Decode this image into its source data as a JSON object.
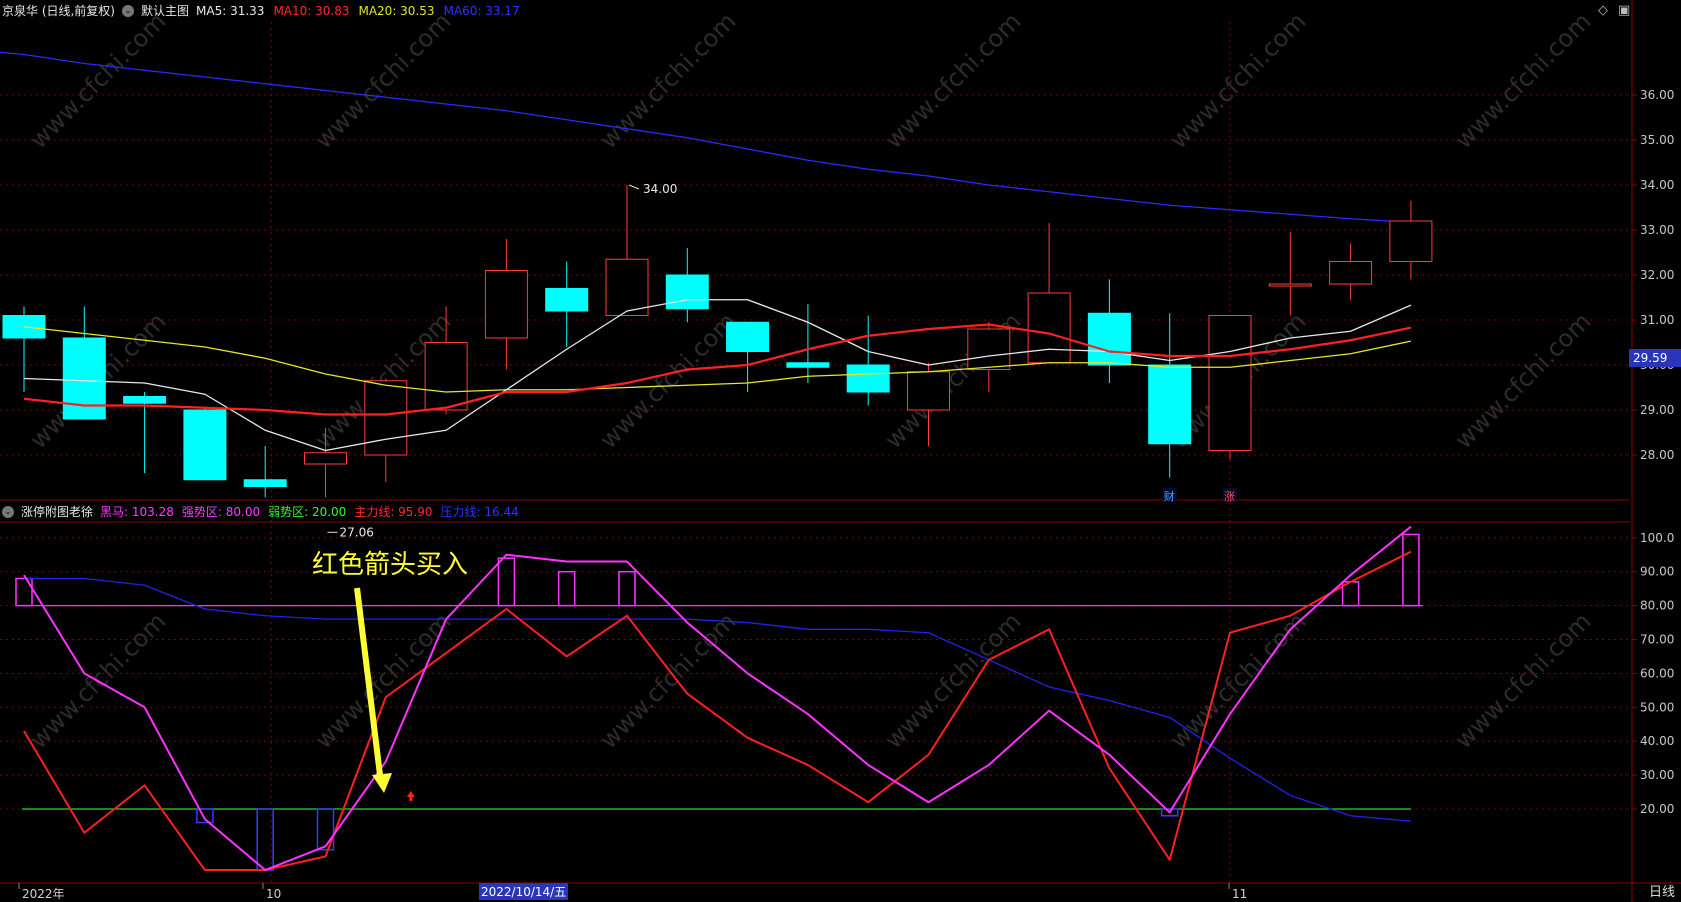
{
  "header": {
    "symbol": "京泉华 (日线,前复权)",
    "main_chart": "默认主图",
    "ma": [
      {
        "label": "MA5: 31.33",
        "color": "#e8e8e8"
      },
      {
        "label": "MA10: 30.83",
        "color": "#ff2a2a"
      },
      {
        "label": "MA20: 30.53",
        "color": "#e6e62a"
      },
      {
        "label": "MA60: 33.17",
        "color": "#2a35ff"
      }
    ]
  },
  "indicator": {
    "name": "涨停附图老徐",
    "lines": [
      {
        "label": "黑马: 103.28",
        "color": "#ff3cff"
      },
      {
        "label": "强势区: 80.00",
        "color": "#ff3cff"
      },
      {
        "label": "弱势区: 20.00",
        "color": "#2aff2a"
      },
      {
        "label": "主力线: 95.90",
        "color": "#ff2a2a"
      },
      {
        "label": "压力线: 16.44",
        "color": "#2a35ff"
      }
    ]
  },
  "annotation": "红色箭头买入",
  "price_axis": {
    "ticks": [
      "36.00",
      "35.00",
      "34.00",
      "33.00",
      "32.00",
      "31.00",
      "30.00",
      "29.00",
      "28.00"
    ],
    "last_price": "29.59"
  },
  "osc_axis": {
    "ticks": [
      "100.0",
      "90.00",
      "80.00",
      "70.00",
      "60.00",
      "50.00",
      "40.00",
      "30.00",
      "20.00"
    ]
  },
  "time_axis": {
    "labels": [
      "2022年",
      "10",
      "11"
    ],
    "highlight": "2022/10/14/五",
    "period": "日线"
  },
  "markers": [
    "财",
    "涨"
  ],
  "watermark": "www.cfchi.com",
  "colors": {
    "up": "#ff3b3b",
    "down": "#00ffff",
    "ma5": "#e8e8e8",
    "ma10": "#ff2020",
    "ma20": "#e6e62a",
    "ma60": "#2a2aff",
    "grid": "#7a0000",
    "magenta": "#ff33ff",
    "green": "#22dd22",
    "axis": "#8a0000",
    "annotation": "#ffff33"
  },
  "chart_data": [
    {
      "type": "candlestick",
      "ylim": [
        27.0,
        36.5
      ],
      "candles": [
        {
          "open": 31.1,
          "close": 30.6,
          "high": 31.3,
          "low": 29.4
        },
        {
          "open": 30.6,
          "close": 28.8,
          "high": 31.3,
          "low": 28.8
        },
        {
          "open": 29.3,
          "close": 29.15,
          "high": 29.4,
          "low": 27.6
        },
        {
          "open": 29.0,
          "close": 27.45,
          "high": 29.05,
          "low": 27.45
        },
        {
          "open": 27.45,
          "close": 27.3,
          "high": 28.2,
          "low": 27.06
        },
        {
          "open": 27.8,
          "close": 28.05,
          "high": 28.6,
          "low": 27.06
        },
        {
          "open": 28.0,
          "close": 29.65,
          "high": 29.7,
          "low": 27.4
        },
        {
          "open": 29.0,
          "close": 30.5,
          "high": 31.3,
          "low": 28.9
        },
        {
          "open": 30.6,
          "close": 32.1,
          "high": 32.8,
          "low": 29.9
        },
        {
          "open": 31.7,
          "close": 31.2,
          "high": 32.3,
          "low": 30.4
        },
        {
          "open": 31.1,
          "close": 32.35,
          "high": 34.0,
          "low": 31.1
        },
        {
          "open": 32.0,
          "close": 31.25,
          "high": 32.6,
          "low": 30.95
        },
        {
          "open": 30.95,
          "close": 30.3,
          "high": 30.95,
          "low": 29.4
        },
        {
          "open": 30.05,
          "close": 29.95,
          "high": 31.35,
          "low": 29.6
        },
        {
          "open": 30.0,
          "close": 29.4,
          "high": 31.1,
          "low": 29.1
        },
        {
          "open": 29.0,
          "close": 29.85,
          "high": 30.05,
          "low": 28.2
        },
        {
          "open": 29.9,
          "close": 30.8,
          "high": 30.95,
          "low": 29.4
        },
        {
          "open": 30.05,
          "close": 31.6,
          "high": 33.15,
          "low": 30.05
        },
        {
          "open": 31.15,
          "close": 30.0,
          "high": 31.9,
          "low": 29.6
        },
        {
          "open": 30.0,
          "close": 28.25,
          "high": 31.15,
          "low": 27.5
        },
        {
          "open": 28.1,
          "close": 31.1,
          "high": 31.1,
          "low": 27.9
        },
        {
          "open": 31.8,
          "close": 31.8,
          "high": 32.95,
          "low": 31.1
        },
        {
          "open": 31.8,
          "close": 32.3,
          "high": 32.7,
          "low": 31.45
        },
        {
          "open": 32.3,
          "close": 33.2,
          "high": 33.65,
          "low": 31.9
        }
      ],
      "ma5": [
        29.7,
        29.65,
        29.6,
        29.35,
        28.55,
        28.1,
        28.35,
        28.55,
        29.45,
        30.35,
        31.2,
        31.45,
        31.45,
        30.95,
        30.3,
        30.0,
        30.2,
        30.35,
        30.3,
        30.1,
        30.3,
        30.6,
        30.75,
        31.33
      ],
      "ma10": [
        29.25,
        29.1,
        29.1,
        29.05,
        29.0,
        28.9,
        28.9,
        29.05,
        29.4,
        29.4,
        29.6,
        29.9,
        30.0,
        30.35,
        30.65,
        30.8,
        30.9,
        30.7,
        30.3,
        30.2,
        30.2,
        30.35,
        30.55,
        30.83
      ],
      "ma20": [
        30.85,
        30.7,
        30.55,
        30.4,
        30.15,
        29.8,
        29.55,
        29.4,
        29.45,
        29.45,
        29.5,
        29.55,
        29.6,
        29.75,
        29.8,
        29.85,
        29.95,
        30.05,
        30.05,
        29.95,
        29.95,
        30.1,
        30.25,
        30.53
      ],
      "ma60": [
        36.9,
        36.7,
        36.55,
        36.4,
        36.25,
        36.1,
        35.95,
        35.8,
        35.65,
        35.45,
        35.25,
        35.05,
        34.8,
        34.55,
        34.35,
        34.2,
        34.0,
        33.85,
        33.7,
        33.55,
        33.45,
        33.35,
        33.25,
        33.17
      ],
      "annotations": [
        {
          "text": "34.00",
          "value": 34.0
        },
        {
          "text": "27.06",
          "value": 27.06
        }
      ]
    },
    {
      "type": "line",
      "ylim": [
        0,
        108
      ],
      "series": [
        {
          "name": "黑马",
          "values": [
            89,
            60,
            50,
            17,
            2,
            9,
            34,
            76,
            95,
            93,
            93,
            75,
            60,
            48,
            33,
            22,
            33,
            49,
            36,
            19,
            48,
            73,
            89,
            103.28
          ]
        },
        {
          "name": "强势区",
          "values": [
            80,
            80,
            80,
            80,
            80,
            80,
            80,
            80,
            80,
            80,
            80,
            80,
            80,
            80,
            80,
            80,
            80,
            80,
            80,
            80,
            80,
            80,
            80,
            80
          ]
        },
        {
          "name": "弱势区",
          "values": [
            20,
            20,
            20,
            20,
            20,
            20,
            20,
            20,
            20,
            20,
            20,
            20,
            20,
            20,
            20,
            20,
            20,
            20,
            20,
            20,
            20,
            20,
            20,
            20
          ]
        },
        {
          "name": "主力线",
          "values": [
            43,
            13,
            27,
            2,
            2,
            6,
            53,
            66,
            79,
            65,
            77,
            54,
            41,
            33,
            22,
            36,
            64,
            73,
            32,
            5,
            72,
            77,
            87,
            95.9
          ]
        },
        {
          "name": "压力线",
          "values": [
            88,
            88,
            86,
            79,
            77,
            76,
            76,
            76,
            76,
            76,
            76,
            76,
            75,
            73,
            73,
            72,
            64,
            56,
            52,
            47,
            35,
            24,
            18,
            16.44
          ]
        }
      ],
      "bars": [
        {
          "index": 0,
          "from": 80,
          "to": 88
        },
        {
          "index": 3,
          "from": 16,
          "to": 20
        },
        {
          "index": 4,
          "from": 2,
          "to": 20
        },
        {
          "index": 5,
          "from": 8,
          "to": 20
        },
        {
          "index": 8,
          "from": 80,
          "to": 94
        },
        {
          "index": 9,
          "from": 80,
          "to": 90
        },
        {
          "index": 10,
          "from": 80,
          "to": 90
        },
        {
          "index": 19,
          "from": 18,
          "to": 20
        },
        {
          "index": 22,
          "from": 80,
          "to": 87
        },
        {
          "index": 23,
          "from": 80,
          "to": 101
        }
      ],
      "buy_signal_index": 6
    }
  ]
}
